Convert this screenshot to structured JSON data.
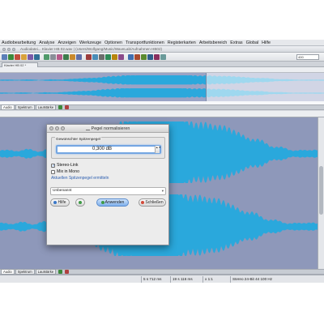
{
  "menubar": {
    "items": [
      "Audiobearbeitung",
      "Analyse",
      "Anzeigen",
      "Werkzeuge",
      "Optionen",
      "Transportfunktionen",
      "Registerkarten",
      "Arbeitsbereich",
      "Extras",
      "Global",
      "Hilfe"
    ]
  },
  "window": {
    "title": "Audiodatei... Klavier HB 02.wav | (Users/Wolfgang/Music/WaveLab/Aufnahmen HB02)"
  },
  "toolbar": {
    "combo_value": "400",
    "colors": [
      "#5b7fb8",
      "#3c8a3c",
      "#c24c3b",
      "#d9a23b",
      "#7a5aa8",
      "#2f6f96",
      "#4f9a6a",
      "#8a8f98",
      "#b65a8a",
      "#3d7c4c",
      "#c98a2d",
      "#5e6fa8",
      "#9c3c3c",
      "#4a8db8",
      "#6d6d6d",
      "#2e8b57",
      "#b8860b",
      "#8b4a8b",
      "#3f6fb0",
      "#a84a2f",
      "#5a8a2f",
      "#2f5f8a",
      "#8a2f5f",
      "#6a9a9a"
    ]
  },
  "file_tab": {
    "label": "Klavier HB 02 *"
  },
  "tabs_upper": [
    "Audio",
    "Spektrum",
    "Lautstärke"
  ],
  "tabs_lower": [
    "Audio",
    "Spektrum",
    "Lautstärke"
  ],
  "status": {
    "time1": "5 s 712 ms",
    "time2": "19 s 116 ms",
    "zoom": "x 1:1",
    "format": "Stereo 24-Bit 44 100 Hz"
  },
  "dialog": {
    "title": "Pegel normalisieren",
    "group_label": "Gewünschter Spitzenpegel",
    "value": "0,300 dB",
    "stepper": "▲▼",
    "stereo_link": "Stereo-Link",
    "stereo_link_checked": true,
    "mix_mono": "Mix in Mono",
    "mix_mono_checked": false,
    "link_text": "Aktuellen Spitzenpegel ermitteln",
    "preset_value": "Unbenannt",
    "preset_symbol": "▾",
    "check_glyph": "✓",
    "buttons": {
      "help": "Hilfe",
      "util": "",
      "apply": "Anwenden",
      "close": "Schließen"
    }
  },
  "colors": {
    "waveform": "#2aa8dc",
    "editor_bg": "#8e98ba",
    "overview_bg": "#9aa3c5"
  }
}
